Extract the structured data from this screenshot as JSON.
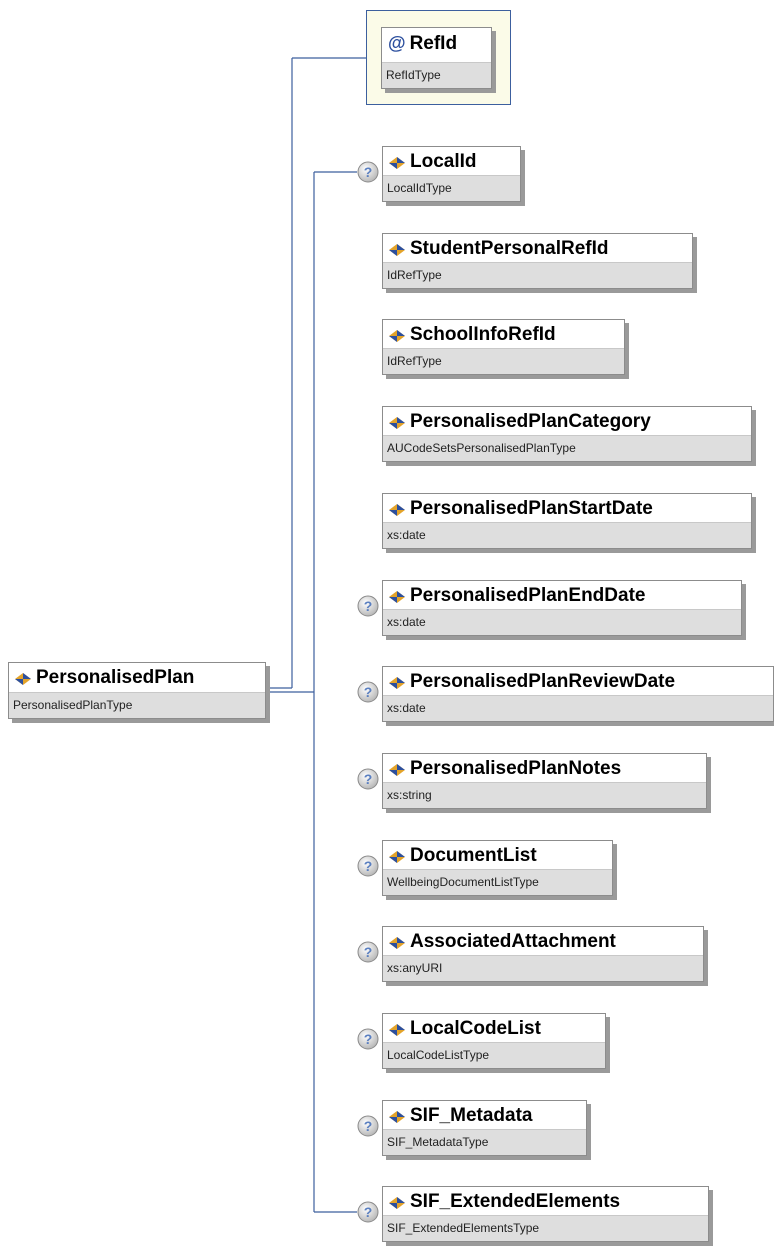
{
  "root": {
    "name": "PersonalisedPlan",
    "type": "PersonalisedPlanType"
  },
  "attribute": {
    "marker": "@",
    "name": "RefId",
    "type": "RefIdType"
  },
  "elements": [
    {
      "name": "LocalId",
      "type": "LocalIdType",
      "optional": true
    },
    {
      "name": "StudentPersonalRefId",
      "type": "IdRefType",
      "optional": false
    },
    {
      "name": "SchoolInfoRefId",
      "type": "IdRefType",
      "optional": false
    },
    {
      "name": "PersonalisedPlanCategory",
      "type": "AUCodeSetsPersonalisedPlanType",
      "optional": false
    },
    {
      "name": "PersonalisedPlanStartDate",
      "type": "xs:date",
      "optional": false
    },
    {
      "name": "PersonalisedPlanEndDate",
      "type": "xs:date",
      "optional": true
    },
    {
      "name": "PersonalisedPlanReviewDate",
      "type": "xs:date",
      "optional": true
    },
    {
      "name": "PersonalisedPlanNotes",
      "type": "xs:string",
      "optional": true
    },
    {
      "name": "DocumentList",
      "type": "WellbeingDocumentListType",
      "optional": true
    },
    {
      "name": "AssociatedAttachment",
      "type": "xs:anyURI",
      "optional": true
    },
    {
      "name": "LocalCodeList",
      "type": "LocalCodeListType",
      "optional": true
    },
    {
      "name": "SIF_Metadata",
      "type": "SIF_MetadataType",
      "optional": true
    },
    {
      "name": "SIF_ExtendedElements",
      "type": "SIF_ExtendedElementsType",
      "optional": true
    }
  ],
  "colors": {
    "connector": "#3c5f9e",
    "attribute_bg": "#fbfbe8",
    "type_bg": "#dedede",
    "optional_badge": "#5a7fc0"
  },
  "icons": {
    "element": "element-diamond-icon",
    "optional": "question-mark-icon",
    "attribute": "at-sign-icon"
  }
}
